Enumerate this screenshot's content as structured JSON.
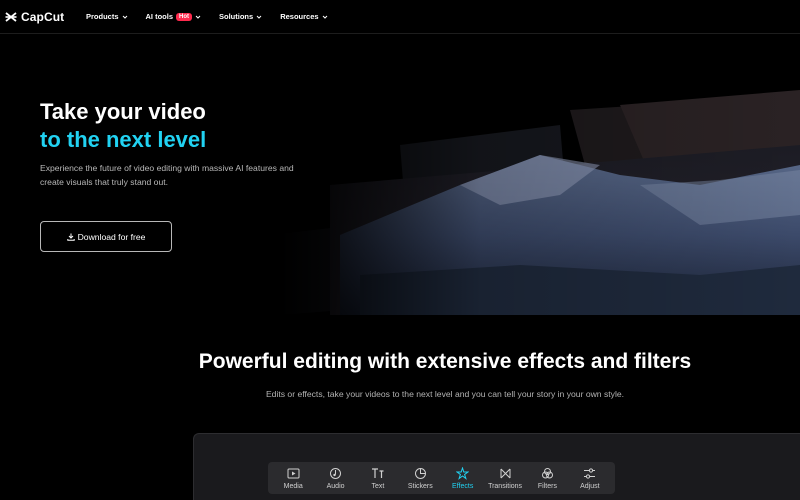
{
  "nav": {
    "brand": "CapCut",
    "items": [
      {
        "label": "Products"
      },
      {
        "label": "AI tools",
        "badge": "Hot"
      },
      {
        "label": "Solutions"
      },
      {
        "label": "Resources"
      }
    ]
  },
  "hero": {
    "title_line1": "Take your video",
    "title_line2": "to the next level",
    "subtitle": "Experience the future of video editing with massive AI features and create visuals that truly stand out.",
    "download_button": "Download for free"
  },
  "section": {
    "title": "Powerful editing with extensive effects and filters",
    "subtitle": "Edits or effects, take your videos to the next level and you can tell your story in your own style."
  },
  "editor": {
    "tabs": [
      {
        "label": "Media",
        "icon": "media-icon"
      },
      {
        "label": "Audio",
        "icon": "audio-icon"
      },
      {
        "label": "Text",
        "icon": "text-icon"
      },
      {
        "label": "Stickers",
        "icon": "stickers-icon"
      },
      {
        "label": "Effects",
        "icon": "effects-icon",
        "active": true
      },
      {
        "label": "Transitions",
        "icon": "transitions-icon"
      },
      {
        "label": "Filters",
        "icon": "filters-icon"
      },
      {
        "label": "Adjust",
        "icon": "adjust-icon"
      }
    ]
  },
  "colors": {
    "accent": "#21d2f2",
    "hot_badge": "#ff2a4d",
    "background": "#000000"
  }
}
